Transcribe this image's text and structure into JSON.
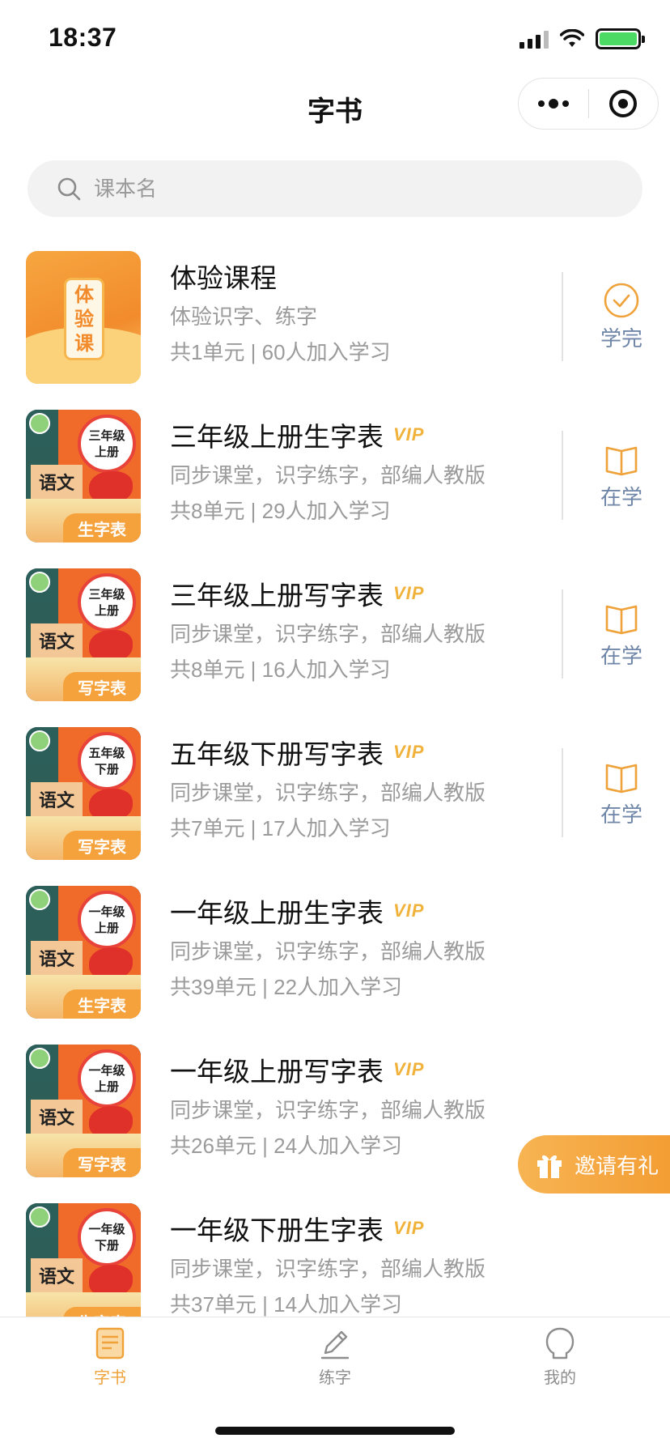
{
  "status_bar": {
    "time": "18:37"
  },
  "nav": {
    "title": "字书"
  },
  "search": {
    "placeholder": "课本名"
  },
  "courses": [
    {
      "title": "体验课程",
      "vip": "",
      "desc": "体验识字、练字",
      "meta": "共1单元 | 60人加入学习",
      "status": "学完",
      "cover": {
        "type": "experience",
        "chars": [
          "体",
          "验",
          "课"
        ]
      }
    },
    {
      "title": "三年级上册生字表",
      "vip": "VIP",
      "desc": "同步课堂，识字练字，部编人教版",
      "meta": "共8单元 | 29人加入学习",
      "status": "在学",
      "cover": {
        "type": "book",
        "grade_lines": [
          "三年级",
          "上册"
        ],
        "subject": "语文",
        "tag": "生字表"
      }
    },
    {
      "title": "三年级上册写字表",
      "vip": "VIP",
      "desc": "同步课堂，识字练字，部编人教版",
      "meta": "共8单元 | 16人加入学习",
      "status": "在学",
      "cover": {
        "type": "book",
        "grade_lines": [
          "三年级",
          "上册"
        ],
        "subject": "语文",
        "tag": "写字表"
      }
    },
    {
      "title": "五年级下册写字表",
      "vip": "VIP",
      "desc": "同步课堂，识字练字，部编人教版",
      "meta": "共7单元 | 17人加入学习",
      "status": "在学",
      "cover": {
        "type": "book",
        "grade_lines": [
          "五年级",
          "下册"
        ],
        "subject": "语文",
        "tag": "写字表"
      }
    },
    {
      "title": "一年级上册生字表",
      "vip": "VIP",
      "desc": "同步课堂，识字练字，部编人教版",
      "meta": "共39单元 | 22人加入学习",
      "status": "",
      "cover": {
        "type": "book",
        "grade_lines": [
          "一年级",
          "上册"
        ],
        "subject": "语文",
        "tag": "生字表"
      }
    },
    {
      "title": "一年级上册写字表",
      "vip": "VIP",
      "desc": "同步课堂，识字练字，部编人教版",
      "meta": "共26单元 | 24人加入学习",
      "status": "",
      "cover": {
        "type": "book",
        "grade_lines": [
          "一年级",
          "上册"
        ],
        "subject": "语文",
        "tag": "写字表"
      }
    },
    {
      "title": "一年级下册生字表",
      "vip": "VIP",
      "desc": "同步课堂，识字练字，部编人教版",
      "meta": "共37单元 | 14人加入学习",
      "status": "",
      "cover": {
        "type": "book",
        "grade_lines": [
          "一年级",
          "下册"
        ],
        "subject": "语文",
        "tag": "生字表"
      }
    }
  ],
  "invite": {
    "label": "邀请有礼"
  },
  "tabs": [
    {
      "label": "字书",
      "icon": "book-icon",
      "active": true
    },
    {
      "label": "练字",
      "icon": "pencil-icon",
      "active": false
    },
    {
      "label": "我的",
      "icon": "profile-icon",
      "active": false
    }
  ],
  "colors": {
    "accent": "#f0a23a",
    "status_blue": "#6f86a8",
    "vip": "#f0b23b",
    "muted_text": "#9b9b9b"
  }
}
